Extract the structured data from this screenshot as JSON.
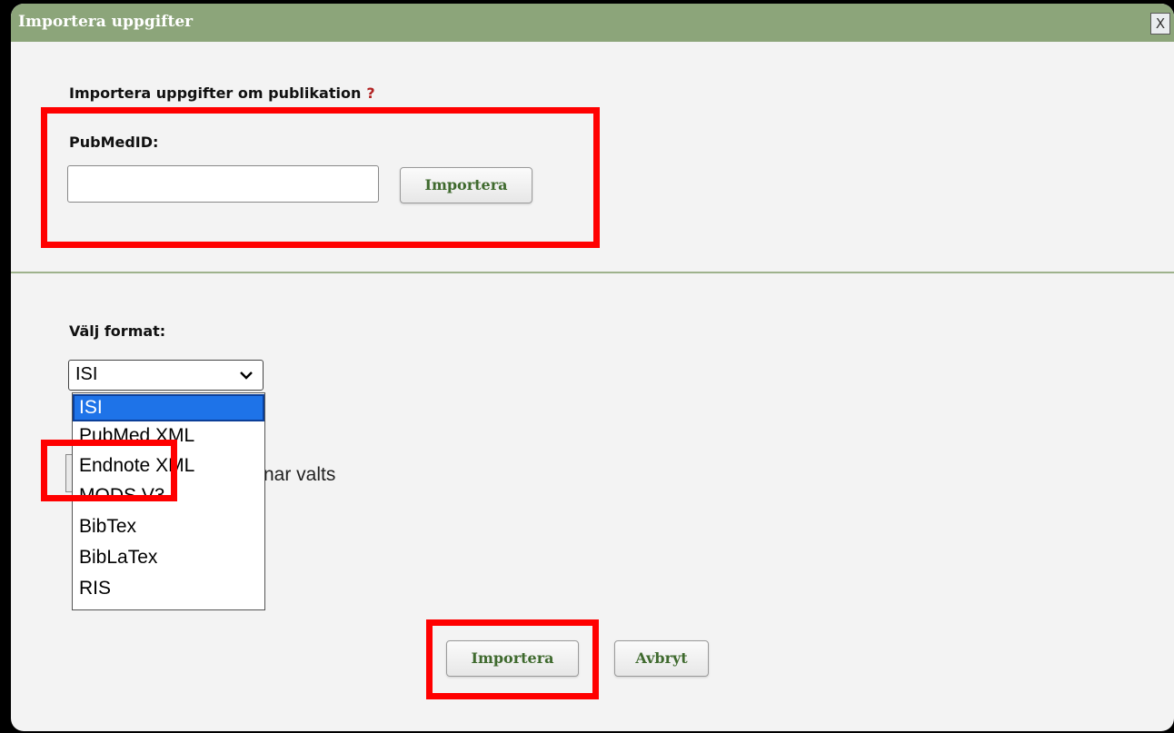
{
  "dialog": {
    "title": "Importera uppgifter",
    "close_label": "X"
  },
  "publication_section": {
    "heading": "Importera uppgifter om publikation",
    "help_mark": "?",
    "pubmed_label": "PubMedID:",
    "pubmed_value": "",
    "import_button": "Importera"
  },
  "format_section": {
    "label": "Välj format:",
    "selected_value": "ISI",
    "options": [
      "ISI",
      "PubMed XML",
      "Endnote XML",
      "MODS V3",
      "BibTex",
      "BibLaTex",
      "RIS"
    ],
    "partially_hidden_text": "nar valts"
  },
  "footer": {
    "import_button": "Importera",
    "cancel_button": "Avbryt"
  },
  "colors": {
    "titlebar": "#8ca57a",
    "button_text": "#3f6a2e",
    "selected_option": "#1e73e8",
    "highlight": "#ff0000"
  },
  "icons": {
    "dropdown": "chevron-down-icon",
    "close": "close-icon"
  }
}
